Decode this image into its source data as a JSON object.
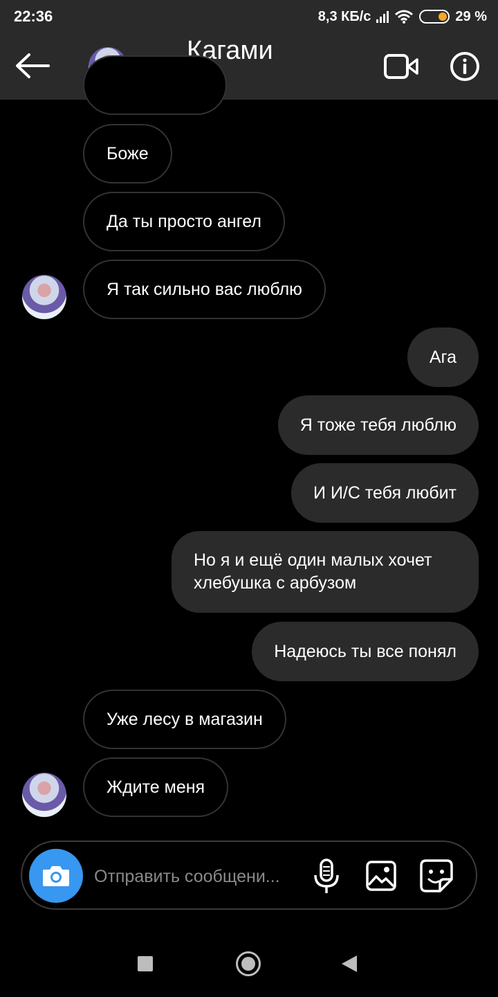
{
  "status_bar": {
    "time": "22:36",
    "network_speed": "8,3 КБ/с",
    "battery_percent": "29 %",
    "battery_level": 0.29
  },
  "header": {
    "title": "Кагами",
    "back_icon": "arrow-left-icon",
    "video_icon": "video-camera-icon",
    "info_icon": "info-icon"
  },
  "messages": [
    {
      "sender": "them",
      "text": "Боже"
    },
    {
      "sender": "them",
      "text": "Да ты просто ангел"
    },
    {
      "sender": "them",
      "text": "Я так сильно вас люблю"
    },
    {
      "sender": "me",
      "text": "Ага"
    },
    {
      "sender": "me",
      "text": "Я тоже тебя люблю"
    },
    {
      "sender": "me",
      "text": "И И/С тебя любит"
    },
    {
      "sender": "me",
      "text": "Но я и ещё один малых хочет хлебушка с арбузом"
    },
    {
      "sender": "me",
      "text": "Надеюсь ты все понял"
    },
    {
      "sender": "them",
      "text": "Уже лесу в магазин"
    },
    {
      "sender": "them",
      "text": "Ждите меня"
    }
  ],
  "composer": {
    "placeholder": "Отправить сообщени..."
  },
  "colors": {
    "background": "#000000",
    "bar": "#2a2a2a",
    "outgoing_bubble": "#2b2b2b",
    "accent": "#3897f0",
    "online": "#3ab83a",
    "battery": "#f5a623"
  }
}
